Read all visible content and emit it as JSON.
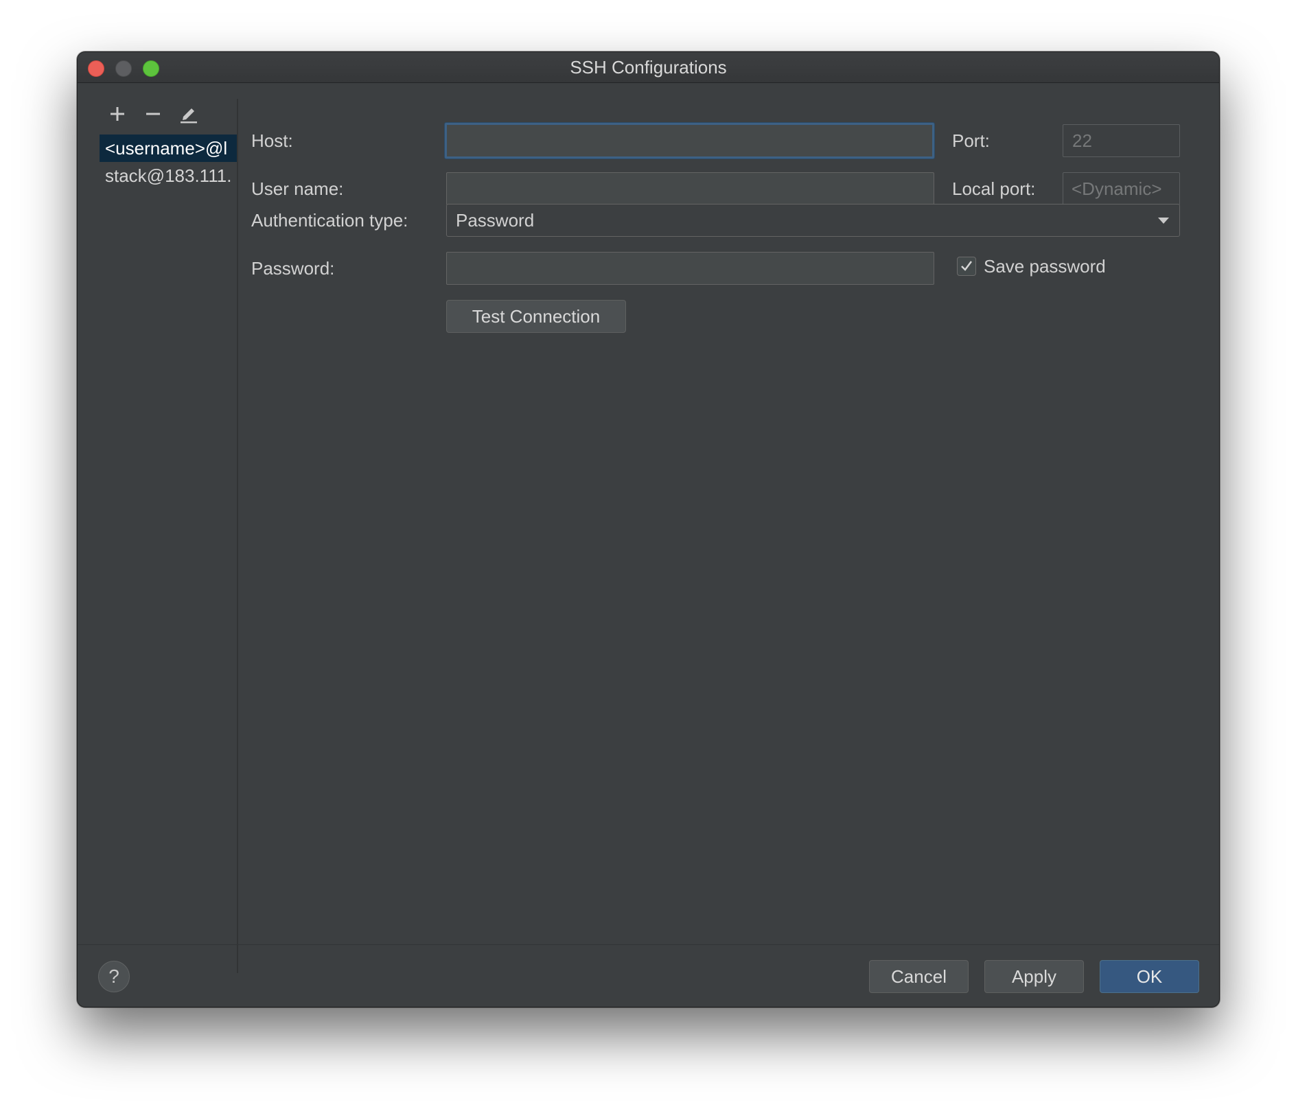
{
  "window": {
    "title": "SSH Configurations"
  },
  "toolbar": {
    "add_icon": "plus-icon",
    "remove_icon": "minus-icon",
    "edit_icon": "pencil-icon"
  },
  "configurations": [
    {
      "label": "<username>@l",
      "selected": true
    },
    {
      "label": "stack@183.111.",
      "selected": false
    }
  ],
  "form": {
    "host_label": "Host:",
    "host_value": "",
    "port_label": "Port:",
    "port_placeholder": "22",
    "username_label": "User name:",
    "username_value": "",
    "local_port_label": "Local port:",
    "local_port_placeholder": "<Dynamic>",
    "auth_type_label": "Authentication type:",
    "auth_type_value": "Password",
    "password_label": "Password:",
    "password_value": "",
    "save_password_label": "Save password",
    "save_password_checked": true,
    "test_connection_label": "Test Connection"
  },
  "footer": {
    "help_label": "?",
    "cancel_label": "Cancel",
    "apply_label": "Apply",
    "ok_label": "OK"
  },
  "colors": {
    "background": "#3c3f41",
    "selection": "#0d293e",
    "focus_border": "#3d6185",
    "primary_button": "#365880",
    "close": "#ec5f57",
    "maximize": "#5dc33d"
  }
}
